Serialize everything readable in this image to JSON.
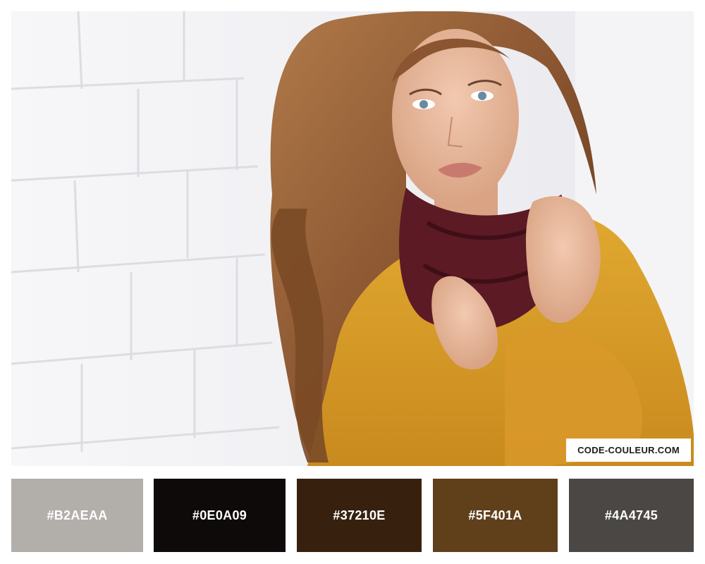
{
  "watermark": "CODE-COULEUR.COM",
  "palette": [
    {
      "hex": "#B2AEAA",
      "label": "#B2AEAA"
    },
    {
      "hex": "#0E0A09",
      "label": "#0E0A09"
    },
    {
      "hex": "#37210E",
      "label": "#37210E"
    },
    {
      "hex": "#5F401A",
      "label": "#5F401A"
    },
    {
      "hex": "#4A4745",
      "label": "#4A4745"
    }
  ],
  "colors": {
    "sweater": "#d49a2a",
    "scarf": "#5c1a24",
    "hair": "#8a5530",
    "skin": "#e6b49c",
    "wall": "#f3f3f5"
  }
}
